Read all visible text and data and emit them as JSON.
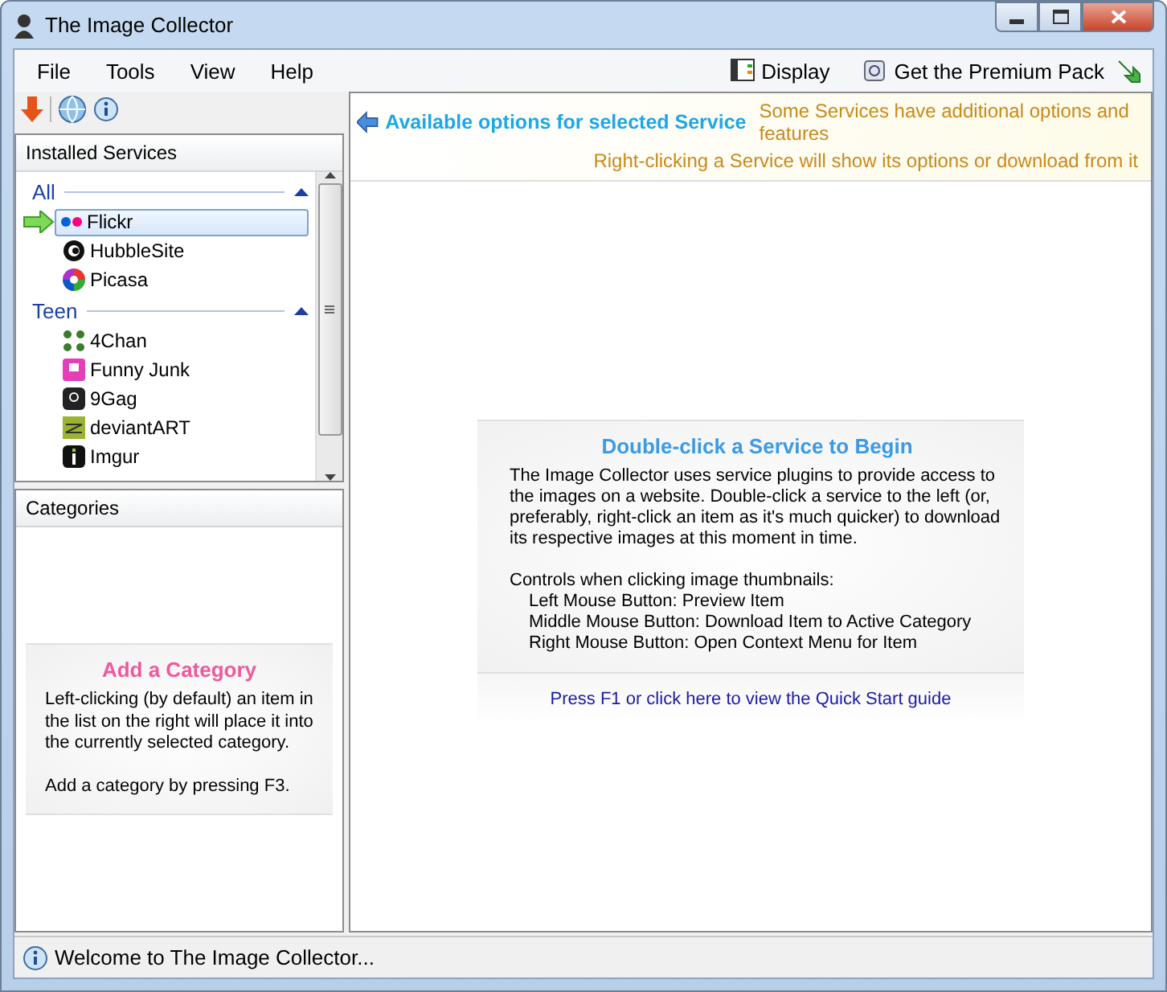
{
  "window": {
    "title": "The Image Collector"
  },
  "menu": [
    "File",
    "Tools",
    "View",
    "Help"
  ],
  "menu_right": [
    {
      "label": "Display"
    },
    {
      "label": "Get the Premium Pack"
    }
  ],
  "services_panel": {
    "title": "Installed Services",
    "groups": [
      {
        "label": "All",
        "expanded": true,
        "items": [
          {
            "name": "Flickr",
            "selected": true
          },
          {
            "name": "HubbleSite",
            "selected": false
          },
          {
            "name": "Picasa",
            "selected": false
          }
        ]
      },
      {
        "label": "Teen",
        "expanded": true,
        "items": [
          {
            "name": "4Chan",
            "selected": false
          },
          {
            "name": "Funny Junk",
            "selected": false
          },
          {
            "name": "9Gag",
            "selected": false
          },
          {
            "name": "deviantART",
            "selected": false
          },
          {
            "name": "Imgur",
            "selected": false
          }
        ]
      }
    ]
  },
  "categories_panel": {
    "title": "Categories",
    "hint_title": "Add a Category",
    "hint_paragraphs": [
      "Left-clicking (by default) an item in the list on the right will place it into the currently selected category.",
      "Add a category by pressing F3."
    ]
  },
  "options_bar": {
    "heading": "Available options for selected Service",
    "notes": [
      "Some Services have additional options and features",
      "Right-clicking a Service will show its options or download from it"
    ]
  },
  "start": {
    "title": "Double-click a Service to Begin",
    "paragraph": "The Image Collector uses service plugins to provide access to the images on a website. Double-click a service to the left (or, preferably, right-click an item as it's much quicker) to download its respective images at this moment in time.",
    "controls_heading": "Controls when clicking image thumbnails:",
    "controls": [
      "Left Mouse Button: Preview Item",
      "Middle Mouse Button: Download Item to Active Category",
      "Right Mouse Button: Open Context Menu for Item"
    ],
    "link": "Press F1 or click here to view the Quick Start guide"
  },
  "status_bar": {
    "text": "Welcome to The Image Collector..."
  }
}
